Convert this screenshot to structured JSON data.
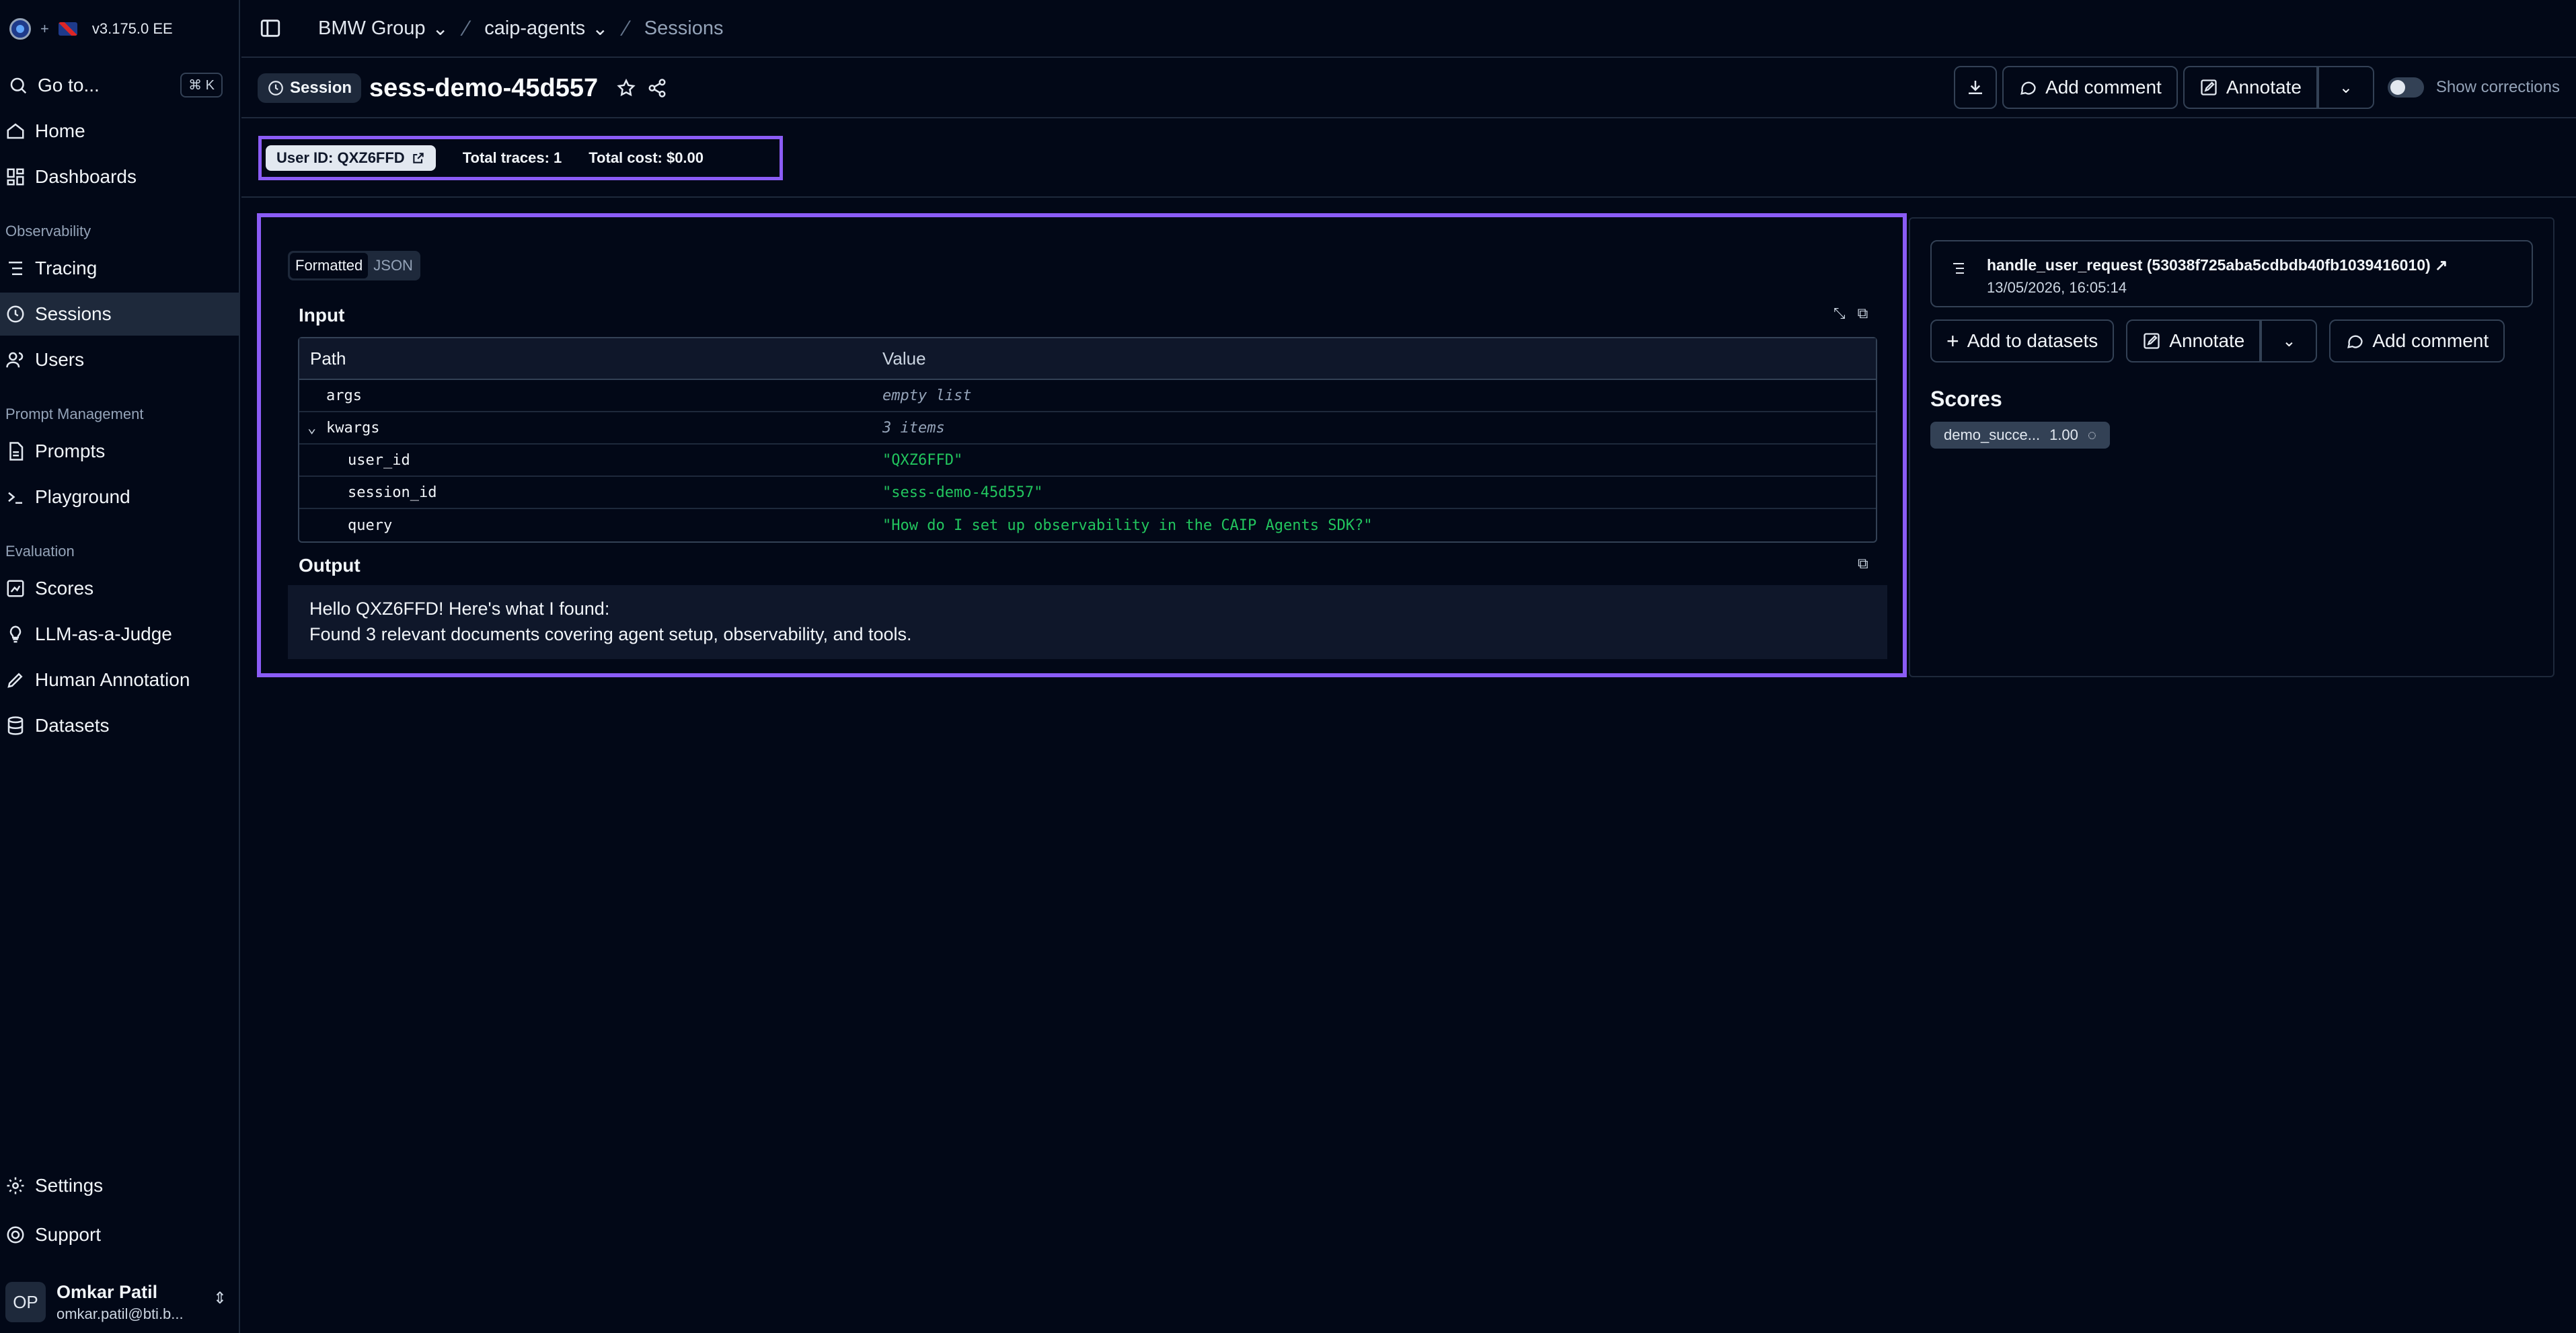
{
  "app": {
    "version": "v3.175.0 EE"
  },
  "goto": {
    "label": "Go to...",
    "shortcut": "⌘ K"
  },
  "nav": {
    "home": "Home",
    "dashboards": "Dashboards",
    "observability_label": "Observability",
    "tracing": "Tracing",
    "sessions": "Sessions",
    "users": "Users",
    "prompt_mgmt_label": "Prompt Management",
    "prompts": "Prompts",
    "playground": "Playground",
    "evaluation_label": "Evaluation",
    "scores": "Scores",
    "llm_judge": "LLM-as-a-Judge",
    "human_annotation": "Human Annotation",
    "datasets": "Datasets",
    "settings": "Settings",
    "support": "Support"
  },
  "user": {
    "initials": "OP",
    "name": "Omkar Patil",
    "email": "omkar.patil@bti.b..."
  },
  "breadcrumb": {
    "org": "BMW Group",
    "project": "caip-agents",
    "page": "Sessions"
  },
  "header": {
    "tag": "Session",
    "title": "sess-demo-45d557",
    "add_comment": "Add comment",
    "annotate": "Annotate",
    "show_corrections": "Show corrections"
  },
  "meta": {
    "user_id": "User ID: QXZ6FFD",
    "total_traces": "Total traces: 1",
    "total_cost": "Total cost: $0.00"
  },
  "view_tabs": {
    "formatted": "Formatted",
    "json": "JSON"
  },
  "input": {
    "title": "Input",
    "col_path": "Path",
    "col_value": "Value",
    "rows": [
      {
        "path": "args",
        "value": "empty list"
      },
      {
        "path": "kwargs",
        "value": "3 items"
      },
      {
        "path": "user_id",
        "value": "\"QXZ6FFD\""
      },
      {
        "path": "session_id",
        "value": "\"sess-demo-45d557\""
      },
      {
        "path": "query",
        "value": "\"How do I set up observability in the CAIP Agents SDK?\""
      }
    ]
  },
  "output": {
    "title": "Output",
    "line1": "Hello QXZ6FFD! Here's what I found:",
    "line2": "Found 3 relevant documents covering agent setup, observability, and tools."
  },
  "trace": {
    "name": "handle_user_request (53038f725aba5cdbdb40fb1039416010)",
    "date": "13/05/2026, 16:05:14",
    "add_to_datasets": "Add to datasets",
    "annotate": "Annotate",
    "add_comment": "Add comment"
  },
  "scores": {
    "title": "Scores",
    "chip_name": "demo_succe...",
    "chip_value": "1.00"
  },
  "colors": {
    "accent": "#8b5cf6",
    "string_value": "#22c55e",
    "background": "#020817"
  }
}
